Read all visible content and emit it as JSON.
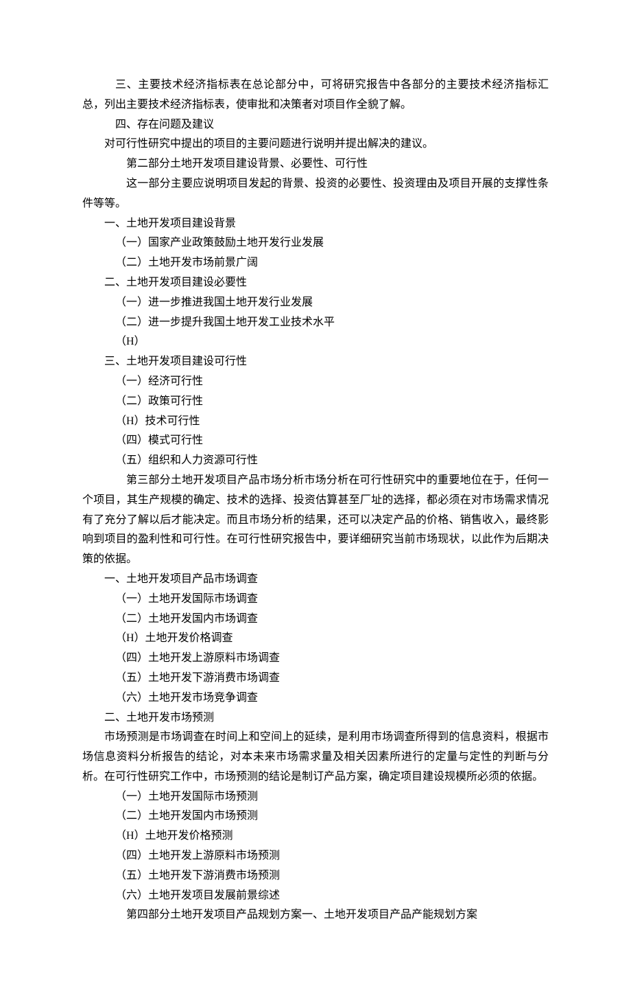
{
  "lines": [
    {
      "indent": 2,
      "text": "三、主要技术经济指标表在总论部分中，可将研究报告中各部分的主要技术经济指标汇总，列出主要技术经济指标表，使审批和决策者对项目作全貌了解。"
    },
    {
      "indent": 2,
      "text": "四、存在问题及建议"
    },
    {
      "indent": 1,
      "text": "对可行性研究中提出的项目的主要问题进行说明并提出解决的建议。"
    },
    {
      "indent": 3,
      "text": "第二部分土地开发项目建设背景、必要性、可行性"
    },
    {
      "indent": 3,
      "text": "这一部分主要应说明项目发起的背景、投资的必要性、投资理由及项目开展的支撑性条件等等。"
    },
    {
      "indent": 1,
      "text": "一、土地开发项目建设背景"
    },
    {
      "indent": 2,
      "text": "（一）国家产业政策鼓励土地开发行业发展"
    },
    {
      "indent": 2,
      "text": "（二）土地开发市场前景广阔"
    },
    {
      "indent": 1,
      "text": "二、土地开发项目建设必要性"
    },
    {
      "indent": 2,
      "text": "（一）进一步推进我国土地开发行业发展"
    },
    {
      "indent": 2,
      "text": "（二）进一步提升我国土地开发工业技术水平"
    },
    {
      "indent": 2,
      "text": "（H）"
    },
    {
      "indent": 1,
      "text": "三、土地开发项目建设可行性"
    },
    {
      "indent": 2,
      "text": "（一）经济可行性"
    },
    {
      "indent": 2,
      "text": "（二）政策可行性"
    },
    {
      "indent": 2,
      "text": "（H）技术可行性"
    },
    {
      "indent": 2,
      "text": "（四）模式可行性"
    },
    {
      "indent": 2,
      "text": "（五）组织和人力资源可行性"
    },
    {
      "indent": 3,
      "text": "第三部分土地开发项目产品市场分析市场分析在可行性研究中的重要地位在于，任何一个项目，其生产规模的确定、技术的选择、投资估算甚至厂址的选择，都必须在对市场需求情况有了充分了解以后才能决定。而且市场分析的结果，还可以决定产品的价格、销售收入，最终影响到项目的盈利性和可行性。在可行性研究报告中，要详细研究当前市场现状，以此作为后期决策的依据。"
    },
    {
      "indent": 1,
      "text": "一、土地开发项目产品市场调查"
    },
    {
      "indent": 2,
      "text": "（一）土地开发国际市场调查"
    },
    {
      "indent": 2,
      "text": "（二）土地开发国内市场调查"
    },
    {
      "indent": 2,
      "text": "（H）土地开发价格调查"
    },
    {
      "indent": 2,
      "text": "（四）土地开发上游原料市场调查"
    },
    {
      "indent": 2,
      "text": "（五）土地开发下游消费市场调查"
    },
    {
      "indent": 2,
      "text": "（六）土地开发市场竞争调查"
    },
    {
      "indent": 1,
      "text": "二、土地开发市场预测"
    },
    {
      "indent": 1,
      "text": "市场预测是市场调查在时间上和空间上的延续，是利用市场调查所得到的信息资料，根据市场信息资料分析报告的结论，对本未来市场需求量及相关因素所进行的定量与定性的判断与分析。在可行性研究工作中，市场预测的结论是制订产品方案，确定项目建设规模所必须的依据。"
    },
    {
      "indent": 2,
      "text": "（一）土地开发国际市场预测"
    },
    {
      "indent": 2,
      "text": "（二）土地开发国内市场预测"
    },
    {
      "indent": 2,
      "text": "（H）土地开发价格预测"
    },
    {
      "indent": 2,
      "text": "（四）土地开发上游原料市场预测"
    },
    {
      "indent": 2,
      "text": "（五）土地开发下游消费市场预测"
    },
    {
      "indent": 2,
      "text": "（六）土地开发项目发展前景综述"
    },
    {
      "indent": 3,
      "text": "第四部分土地开发项目产品规划方案一、土地开发项目产品产能规划方案"
    }
  ]
}
